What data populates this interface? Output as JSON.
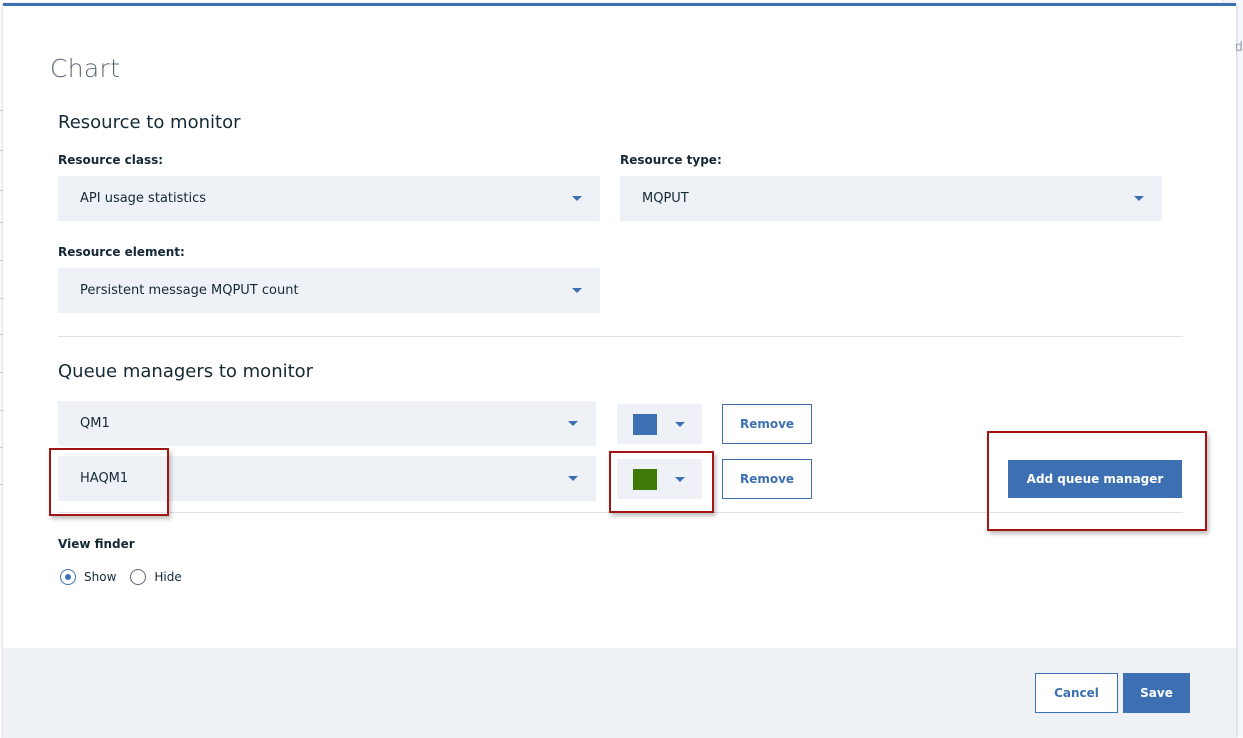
{
  "background": {
    "side_text": "d"
  },
  "dialog": {
    "title": "Chart"
  },
  "resource_section": {
    "title": "Resource to monitor",
    "class_label": "Resource class:",
    "class_value": "API usage statistics",
    "type_label": "Resource type:",
    "type_value": "MQPUT",
    "element_label": "Resource element:",
    "element_value": "Persistent message MQPUT count"
  },
  "qm_section": {
    "title": "Queue managers to monitor",
    "rows": [
      {
        "name": "QM1",
        "color": "#3d70b2",
        "remove_label": "Remove"
      },
      {
        "name": "HAQM1",
        "color": "#3d7a07",
        "remove_label": "Remove"
      }
    ],
    "add_label": "Add queue manager"
  },
  "view_finder": {
    "label": "View finder",
    "options": [
      {
        "label": "Show",
        "checked": true
      },
      {
        "label": "Hide",
        "checked": false
      }
    ]
  },
  "footer": {
    "cancel_label": "Cancel",
    "save_label": "Save"
  },
  "colors": {
    "accent": "#3d70b2",
    "highlight": "#a31515",
    "field_bg": "#eef1f6"
  }
}
